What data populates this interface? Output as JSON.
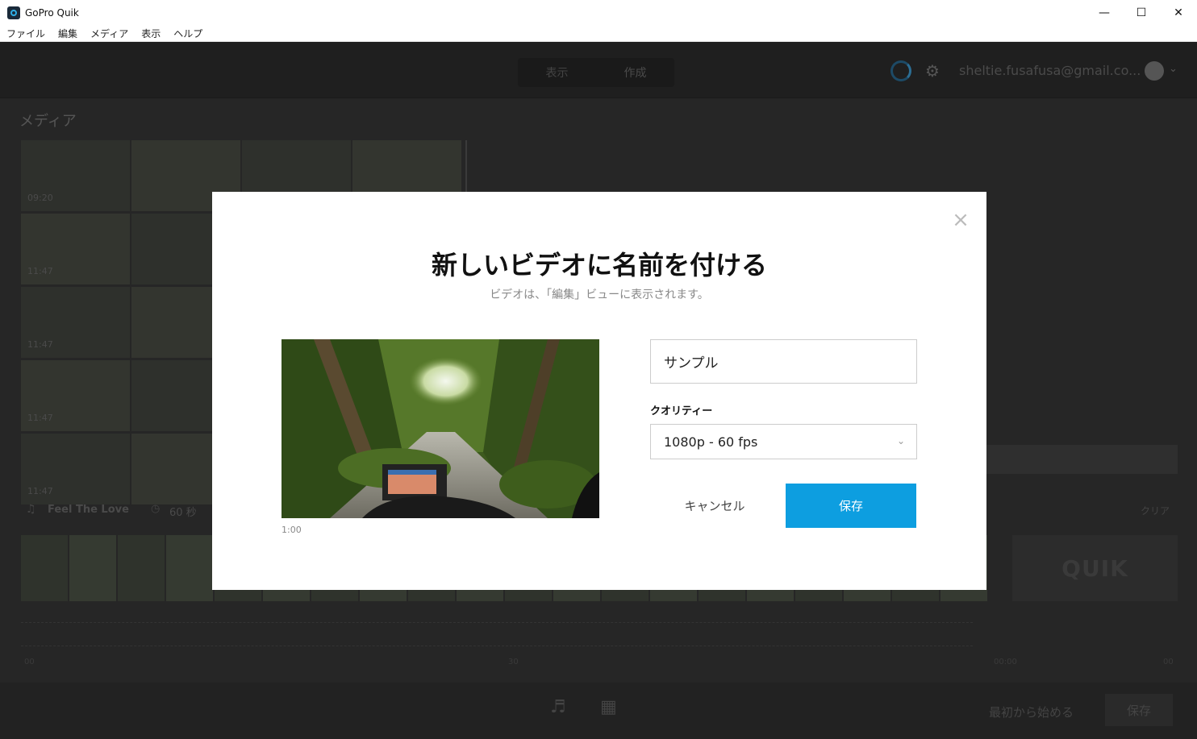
{
  "window": {
    "title": "GoPro Quik",
    "minimize": "—",
    "maximize": "☐",
    "close": "✕"
  },
  "menu": [
    "ファイル",
    "編集",
    "メディア",
    "表示",
    "ヘルプ"
  ],
  "topbar": {
    "tabs": [
      "表示",
      "作成"
    ],
    "account": "sheltie.fusafusa@gmail.co..."
  },
  "media": {
    "title": "メディア",
    "durations": [
      "09:20",
      "11:47",
      "11:47",
      "11:47",
      "11:47"
    ]
  },
  "track": {
    "song": "Feel The Love",
    "duration": "60 秒",
    "clear": "クリア"
  },
  "timeline": {
    "tick_start": "00",
    "tick_mid": "30",
    "tick_end_a": "00:00",
    "tick_end_b": "00"
  },
  "brand": {
    "logo_text": "QUIK"
  },
  "bottombar": {
    "start_label": "最初から始める",
    "save_label": "保存"
  },
  "modal": {
    "title": "新しいビデオに名前を付ける",
    "subtitle": "ビデオは、「編集」ビューに表示されます。",
    "duration": "1:00",
    "name_value": "サンプル",
    "quality_label": "クオリティー",
    "quality_value": "1080p - 60 fps",
    "cancel": "キャンセル",
    "save": "保存",
    "close_symbol": "×"
  },
  "colors": {
    "accent": "#0d9ee0",
    "backdrop": "#262626"
  }
}
